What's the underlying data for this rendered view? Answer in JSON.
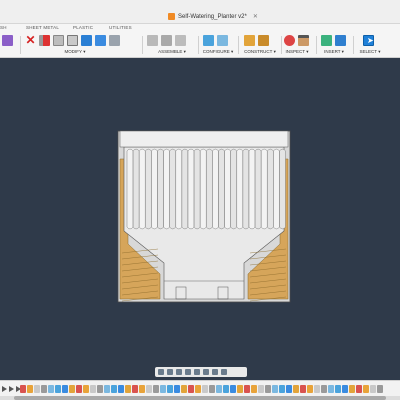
{
  "window": {
    "doc_title": "Self-Watering_Planter v2*",
    "doc_icon": "fusion-cube-icon"
  },
  "ribbon_tabs": [
    "SH",
    "SHEET METAL",
    "PLASTIC",
    "UTILITIES"
  ],
  "toolbar": {
    "modify": "MODIFY ▾",
    "assemble": "ASSEMBLE ▾",
    "configure": "CONFIGURE ▾",
    "construct": "CONSTRUCT ▾",
    "inspect": "INSPECT ▾",
    "insert": "INSERT ▾",
    "select": "SELECT ▾"
  },
  "colors": {
    "viewport_bg": "#2f3a4a",
    "model_body": "#d8d8d8",
    "model_edge": "#4a4a4a",
    "model_section": "#d6a55a",
    "accent": "#1f80d8"
  },
  "icons": {
    "navbar": [
      "orbit-icon",
      "pan-icon",
      "look-at-icon",
      "zoom-icon",
      "fit-icon",
      "display-settings-icon",
      "grid-icon",
      "viewports-icon"
    ],
    "timeline_controls": [
      "first-icon",
      "prev-icon",
      "play-icon",
      "next-icon",
      "last-icon"
    ]
  }
}
